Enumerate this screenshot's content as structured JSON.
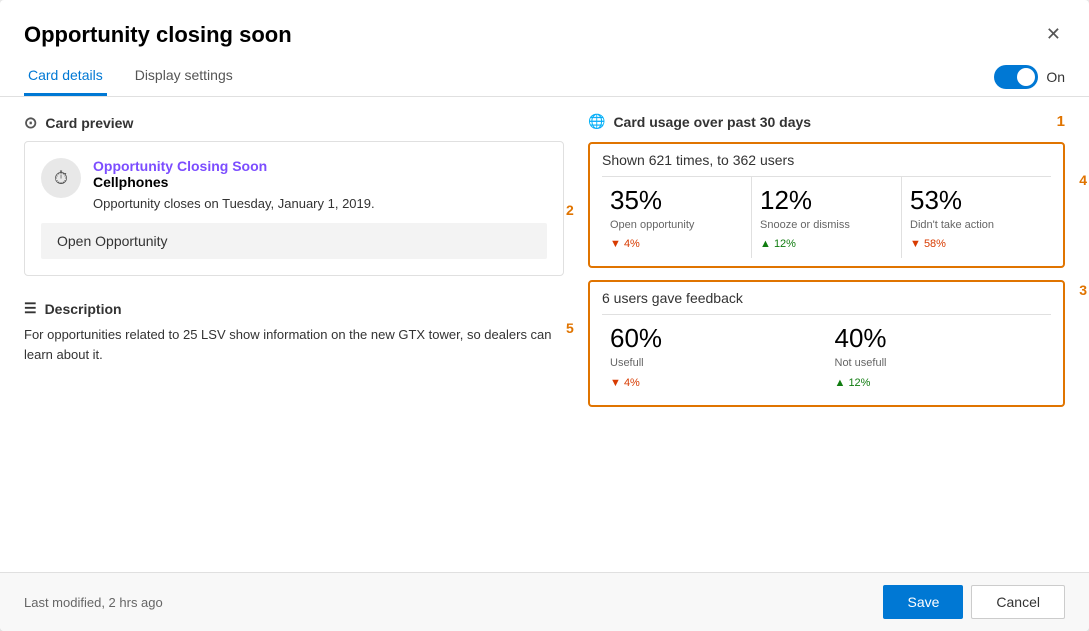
{
  "dialog": {
    "title": "Opportunity closing soon",
    "close_label": "✕"
  },
  "tabs": {
    "card_details": "Card details",
    "display_settings": "Display settings",
    "active": "card_details",
    "toggle_label": "On"
  },
  "card_preview": {
    "section_label": "Card preview",
    "card_title": "Opportunity Closing Soon",
    "card_subtitle": "Cellphones",
    "card_body": "Opportunity closes on Tuesday, January 1, 2019.",
    "card_action": "Open Opportunity"
  },
  "description": {
    "label": "Description",
    "text": "For opportunities related to 25 LSV show information on the new GTX tower, so dealers can learn about it."
  },
  "usage": {
    "section_label": "Card usage over past 30 days",
    "number_label": "1",
    "shown_text": "Shown 621 times, to 362 users",
    "stats": [
      {
        "pct": "35%",
        "label": "Open opportunity",
        "delta": "▼ 4%",
        "delta_type": "down"
      },
      {
        "pct": "12%",
        "label": "Snooze or dismiss",
        "delta": "▲ 12%",
        "delta_type": "up"
      },
      {
        "pct": "53%",
        "label": "Didn't take action",
        "delta": "▼ 58%",
        "delta_type": "down"
      }
    ],
    "ann2": "2",
    "ann3": "3",
    "ann4": "4",
    "feedback": {
      "title": "6 users gave feedback",
      "items": [
        {
          "pct": "60%",
          "label": "Usefull",
          "delta": "▼ 4%",
          "delta_type": "down"
        },
        {
          "pct": "40%",
          "label": "Not usefull",
          "delta": "▲ 12%",
          "delta_type": "up"
        }
      ],
      "ann5": "5"
    }
  },
  "footer": {
    "timestamp": "Last modified, 2 hrs ago",
    "save_label": "Save",
    "cancel_label": "Cancel"
  }
}
